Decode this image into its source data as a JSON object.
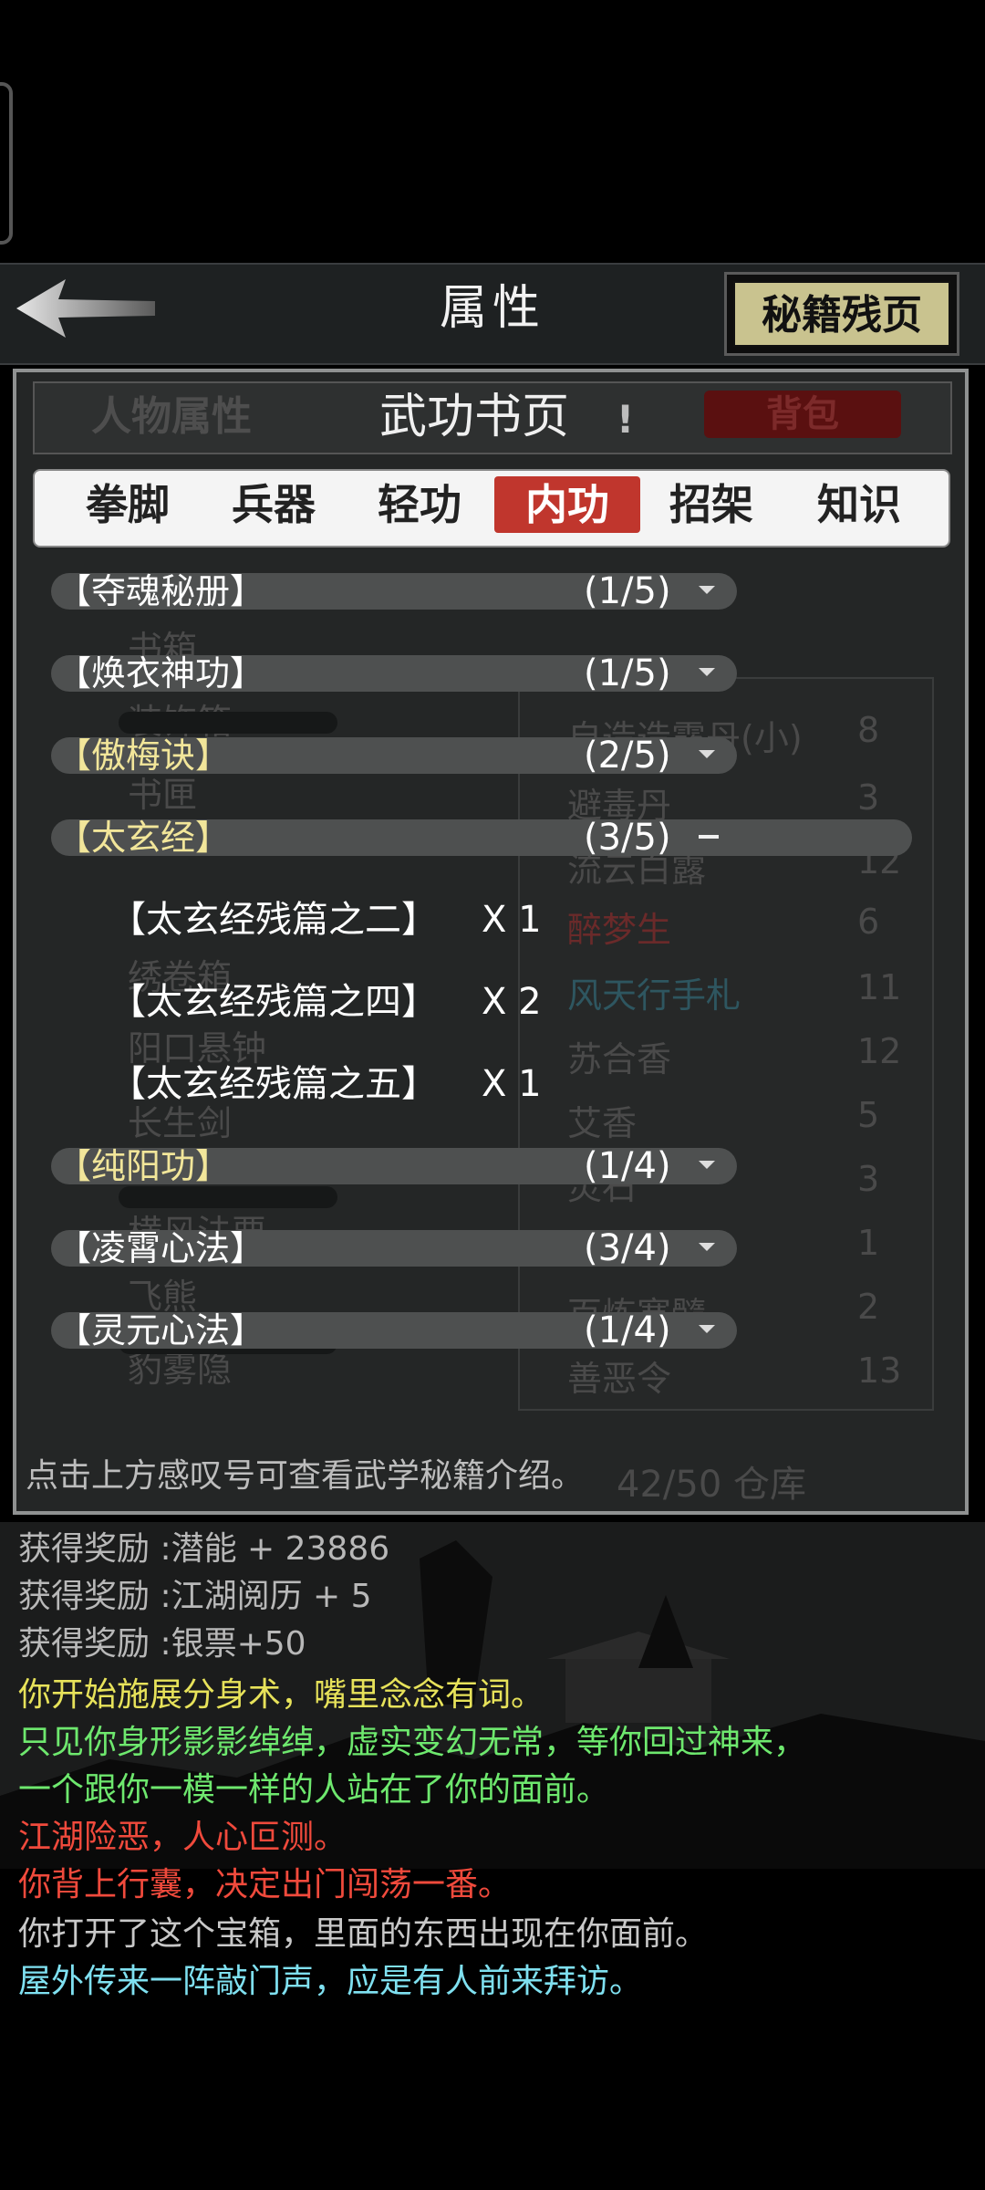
{
  "header": {
    "title": "属性",
    "back_icon": "back-arrow-icon",
    "secret_button_label": "秘籍残页"
  },
  "subtabs": {
    "character": "人物属性",
    "martial": "武功书页",
    "exclaim": "!",
    "bag": "背包"
  },
  "category_tabs": [
    {
      "label": "拳脚",
      "active": false
    },
    {
      "label": "兵器",
      "active": false
    },
    {
      "label": "轻功",
      "active": false
    },
    {
      "label": "内功",
      "active": true
    },
    {
      "label": "招架",
      "active": false
    },
    {
      "label": "知识",
      "active": false
    }
  ],
  "skills": [
    {
      "name": "【夺魂秘册】",
      "count": "(1/5)",
      "color": "white",
      "expanded": false
    },
    {
      "name": "【焕衣神功】",
      "count": "(1/5)",
      "color": "white",
      "expanded": false
    },
    {
      "name": "【傲梅诀】",
      "count": "(2/5)",
      "color": "gold",
      "expanded": false
    },
    {
      "name": "【太玄经】",
      "count": "(3/5)",
      "color": "gold",
      "expanded": true,
      "fragments": [
        {
          "name": "【太玄经残篇之二】",
          "qty": "X 1"
        },
        {
          "name": "【太玄经残篇之四】",
          "qty": "X 2"
        },
        {
          "name": "【太玄经残篇之五】",
          "qty": "X 1"
        }
      ]
    },
    {
      "name": "【纯阳功】",
      "count": "(1/4)",
      "color": "gold",
      "expanded": false
    },
    {
      "name": "【凌霄心法】",
      "count": "(3/4)",
      "color": "white",
      "expanded": false
    },
    {
      "name": "【灵元心法】",
      "count": "(1/4)",
      "color": "white",
      "expanded": false
    }
  ],
  "hint": "点击上方感叹号可查看武学秘籍介绍。",
  "background_panel": {
    "left_items": [
      "书箱",
      "装饰箱",
      "书匣",
      "绣卷箱",
      "阳口悬钟",
      "长生剑",
      "横风法要",
      "飞熊",
      "豹雾隐"
    ],
    "right_items": [
      {
        "name": "自造造露丹(小)",
        "count": "8"
      },
      {
        "name": "避毒丹",
        "count": "3"
      },
      {
        "name": "流云白露",
        "count": "12"
      },
      {
        "name": "醉梦生",
        "count": "6"
      },
      {
        "name": "风天行手札",
        "count": "11"
      },
      {
        "name": "苏合香",
        "count": "12"
      },
      {
        "name": "艾香",
        "count": "5"
      },
      {
        "name": "灵石",
        "count": "3"
      },
      {
        "name": "",
        "count": "1"
      },
      {
        "name": "百炼寒髓",
        "count": "2"
      },
      {
        "name": "善恶令",
        "count": "13"
      }
    ],
    "storage": "42/50 仓库"
  },
  "log": [
    {
      "text": "获得奖励 :潜能 + 23886",
      "color": "#b8b8b8"
    },
    {
      "text": "获得奖励 :江湖阅历 + 5",
      "color": "#b8b8b8"
    },
    {
      "text": "获得奖励 :银票+50",
      "color": "#b8b8b8"
    },
    {
      "text": "你开始施展分身术，嘴里念念有词。",
      "color": "#e7e25a"
    },
    {
      "text": "只见你身形影影绰绰，虚实变幻无常，等你回过神来，",
      "color": "#6ee86e"
    },
    {
      "text": "一个跟你一模一样的人站在了你的面前。",
      "color": "#6ee86e"
    },
    {
      "text": "江湖险恶，人心叵测。",
      "color": "#f04a3c"
    },
    {
      "text": "你背上行囊，决定出门闯荡一番。",
      "color": "#f04a3c"
    },
    {
      "text": "你打开了这个宝箱，里面的东西出现在你面前。",
      "color": "#c8c8c8"
    },
    {
      "text": "屋外传来一阵敲门声，应是有人前来拜访。",
      "color": "#7fe0f0"
    }
  ]
}
